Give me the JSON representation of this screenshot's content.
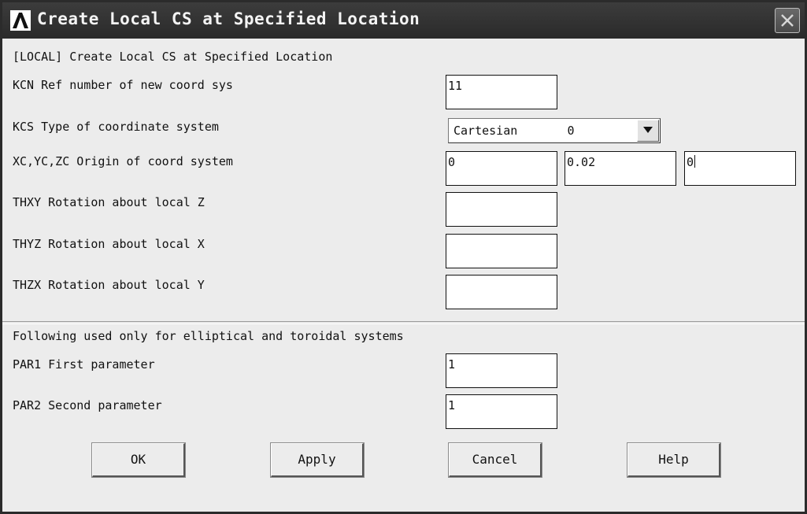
{
  "window": {
    "title": "Create Local CS at Specified Location",
    "logo_icon": "ansys-logo-icon",
    "close_icon": "close-icon"
  },
  "header": "[LOCAL]  Create Local CS at Specified Location",
  "rows": {
    "kcn": {
      "label": "KCN  Ref number of new coord sys",
      "value": "11"
    },
    "kcs": {
      "label": "KCS  Type of coordinate system",
      "selected": "Cartesian       0"
    },
    "origin": {
      "label": "XC,YC,ZC  Origin of coord system",
      "x": "0",
      "y": "0.02",
      "z": "0"
    },
    "thxy": {
      "label": "THXY  Rotation about local Z",
      "value": ""
    },
    "thyz": {
      "label": "THYZ  Rotation about local X",
      "value": ""
    },
    "thzx": {
      "label": "THZX  Rotation about local Y",
      "value": ""
    }
  },
  "note": "Following used only for elliptical and toroidal systems",
  "params": {
    "par1": {
      "label": "PAR1  First parameter",
      "value": "1"
    },
    "par2": {
      "label": "PAR2  Second parameter",
      "value": "1"
    }
  },
  "buttons": {
    "ok": "OK",
    "apply": "Apply",
    "cancel": "Cancel",
    "help": "Help"
  },
  "colors": {
    "titlebar": "#2f2f2f",
    "dialog": "#ececec",
    "field": "#ffffff"
  }
}
